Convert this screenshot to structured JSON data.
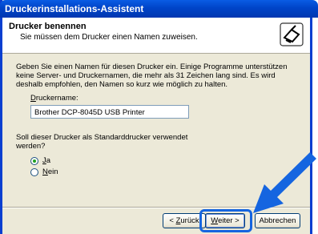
{
  "window": {
    "title": "Druckerinstallations-Assistent"
  },
  "header": {
    "title": "Drucker benennen",
    "subtitle": "Sie müssen dem Drucker einen Namen zuweisen."
  },
  "body": {
    "description": "Geben Sie einen Namen für diesen Drucker ein. Einige Programme unterstützen keine Server- und Druckernamen, die mehr als 31 Zeichen lang sind. Es wird deshalb empfohlen, den Namen so kurz wie möglich zu halten."
  },
  "printer_name": {
    "label_mnemonic": "D",
    "label_rest": "ruckername:",
    "value": "Brother DCP-8045D USB Printer"
  },
  "default_printer": {
    "question": "Soll dieser Drucker als Standarddrucker verwendet werden?",
    "options": [
      {
        "mnemonic": "J",
        "rest": "a",
        "selected": true
      },
      {
        "mnemonic": "N",
        "rest": "ein",
        "selected": false
      }
    ]
  },
  "buttons": {
    "back_prefix": "< ",
    "back_mnemonic": "Z",
    "back_rest": "urück",
    "next_mnemonic": "W",
    "next_rest": "eiter >",
    "cancel": "Abbrechen"
  },
  "colors": {
    "title_bar": "#0a5ce4",
    "highlight": "#1565e0",
    "arrow": "#1565e0"
  },
  "icons": {
    "header": "printer-wizard-icon",
    "pointer": "arrow-icon"
  }
}
